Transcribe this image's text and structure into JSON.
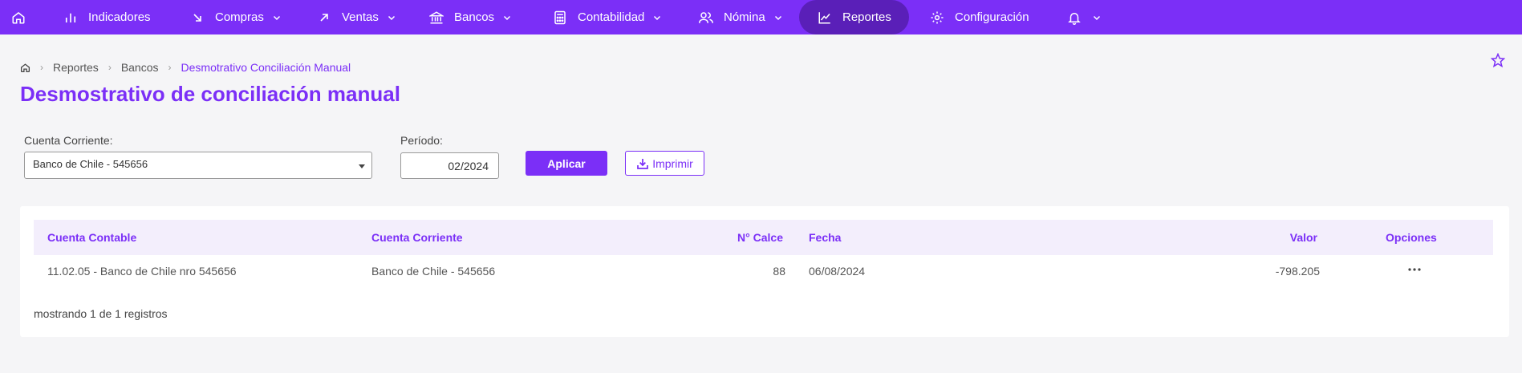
{
  "nav": {
    "items": [
      {
        "label": "Indicadores",
        "icon": "bar-chart-icon",
        "has_dropdown": false
      },
      {
        "label": "Compras",
        "icon": "arrow-down-right-icon",
        "has_dropdown": true
      },
      {
        "label": "Ventas",
        "icon": "arrow-up-right-icon",
        "has_dropdown": true
      },
      {
        "label": "Bancos",
        "icon": "bank-icon",
        "has_dropdown": true
      },
      {
        "label": "Contabilidad",
        "icon": "calculator-icon",
        "has_dropdown": true
      },
      {
        "label": "Nómina",
        "icon": "users-icon",
        "has_dropdown": true
      },
      {
        "label": "Reportes",
        "icon": "line-chart-icon",
        "has_dropdown": false,
        "active": true
      },
      {
        "label": "Configuración",
        "icon": "gear-icon",
        "has_dropdown": false
      },
      {
        "label": "",
        "icon": "bell-icon",
        "has_dropdown": true
      }
    ]
  },
  "breadcrumb": {
    "items": [
      "Reportes",
      "Bancos"
    ],
    "current": "Desmotrativo Conciliación Manual"
  },
  "page": {
    "title": "Desmostrativo de conciliación manual"
  },
  "filters": {
    "account_label": "Cuenta Corriente:",
    "account_value": "Banco de Chile - 545656",
    "period_label": "Período:",
    "period_value": "02/2024",
    "apply_label": "Aplicar",
    "print_label": "Imprimir"
  },
  "table": {
    "columns": [
      "Cuenta Contable",
      "Cuenta Corriente",
      "N° Calce",
      "Fecha",
      "Valor",
      "Opciones"
    ],
    "rows": [
      {
        "cuenta_contable": "11.02.05 - Banco de Chile nro 545656",
        "cuenta_corriente": "Banco de Chile - 545656",
        "n_calce": "88",
        "fecha": "06/08/2024",
        "valor": "-798.205"
      }
    ],
    "footer": "mostrando 1 de 1 registros"
  },
  "colors": {
    "accent": "#7b2ff7",
    "nav_active": "#5a1fb8",
    "table_header_bg": "#f3eefc"
  }
}
